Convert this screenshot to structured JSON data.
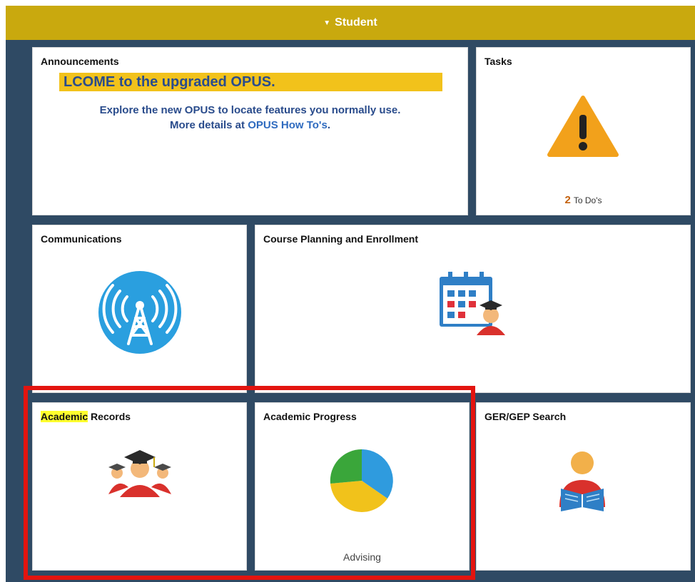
{
  "header": {
    "title": "Student",
    "caret_icon": "caret-down-icon"
  },
  "tiles": {
    "announcements": {
      "title": "Announcements",
      "headline": "LCOME to the upgraded OPUS.",
      "line1": "Explore the new OPUS to locate features you normally use.",
      "line2_prefix": "More details at ",
      "line2_link": "OPUS How To's",
      "line2_suffix": "."
    },
    "tasks": {
      "title": "Tasks",
      "icon": "warning-icon",
      "count": "2",
      "count_label": "To Do's"
    },
    "communications": {
      "title": "Communications",
      "icon": "broadcast-tower-icon"
    },
    "course_planning": {
      "title": "Course Planning and Enrollment",
      "icon": "calendar-graduate-icon"
    },
    "academic_records": {
      "title_highlight": "Academic",
      "title_rest": " Records",
      "icon": "graduates-icon"
    },
    "academic_progress": {
      "title": "Academic Progress",
      "icon": "pie-chart-icon",
      "footer": "Advising"
    },
    "ger_search": {
      "title": "GER/GEP Search",
      "icon": "reader-icon"
    }
  },
  "colors": {
    "header": "#c9a90e",
    "background": "#2f4a64",
    "highlight_box": "#e3140f",
    "headline_bg": "#f2c21b",
    "link": "#2f6bbf"
  }
}
